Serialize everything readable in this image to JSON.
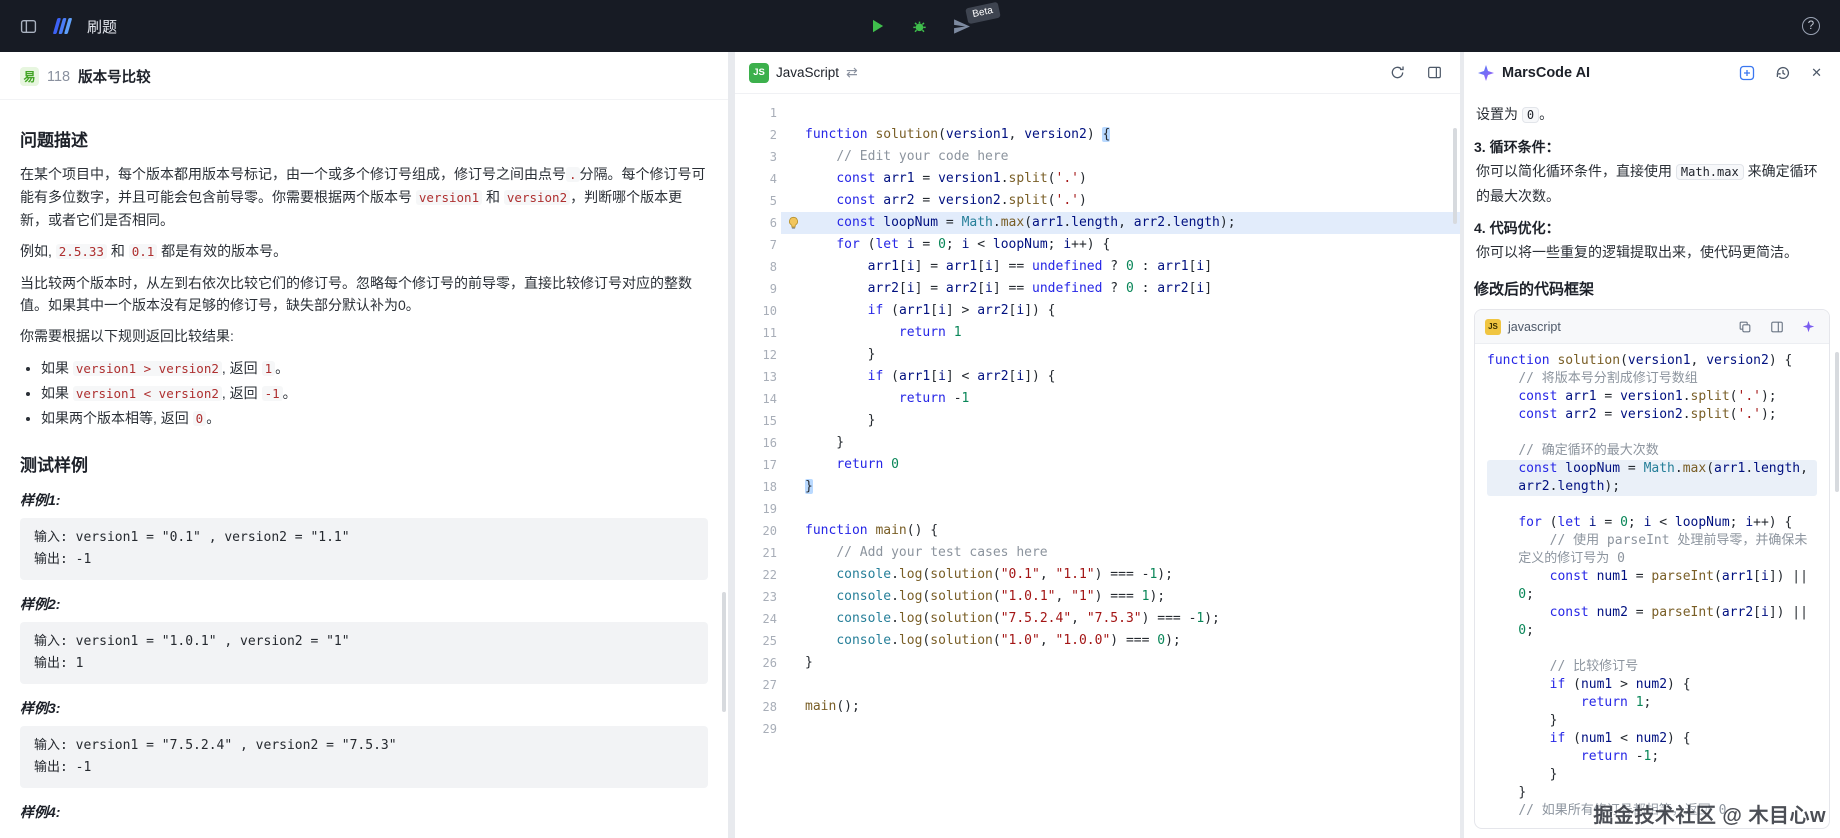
{
  "colors": {
    "topbar_bg": "#171b24",
    "accent_green": "#3fbf4c",
    "brand_blue": "#4a7df7",
    "badge_green_bg": "#e7f6df",
    "badge_green_text": "#41a423",
    "active_line_bg": "#e2ecfb",
    "ai_highlight_bg": "#eaf0f8"
  },
  "icons": {
    "swap": "⇄",
    "help": "?",
    "close": "✕"
  },
  "topbar": {
    "brand": "刷题",
    "beta": "Beta"
  },
  "problem": {
    "difficulty": "易",
    "id": "118",
    "title": "版本号比较",
    "desc_heading": "问题描述",
    "paragraphs": [
      [
        {
          "t": "在某个项目中，每个版本都用版本号标记，由一个或多个修订号组成，修订号之间由点号"
        },
        {
          "t": ".",
          "c": true
        },
        {
          "t": "分隔。每个修订号可能有多位数字，并且可能会包含前导零。你需要根据两个版本号 "
        },
        {
          "t": "version1",
          "c": true
        },
        {
          "t": " 和 "
        },
        {
          "t": "version2",
          "c": true
        },
        {
          "t": "，判断哪个版本更新，或者它们是否相同。"
        }
      ],
      [
        {
          "t": "例如, "
        },
        {
          "t": "2.5.33",
          "c": true
        },
        {
          "t": " 和 "
        },
        {
          "t": "0.1",
          "c": true
        },
        {
          "t": " 都是有效的版本号。"
        }
      ],
      [
        {
          "t": "当比较两个版本时，从左到右依次比较它们的修订号。忽略每个修订号的前导零，直接比较修订号对应的整数值。如果其中一个版本没有足够的修订号，缺失部分默认补为0。"
        }
      ],
      [
        {
          "t": "你需要根据以下规则返回比较结果:"
        }
      ]
    ],
    "rules": [
      [
        {
          "t": "如果 "
        },
        {
          "t": "version1 > version2",
          "c": true
        },
        {
          "t": ", 返回 "
        },
        {
          "t": "1",
          "c": true
        },
        {
          "t": "。"
        }
      ],
      [
        {
          "t": "如果 "
        },
        {
          "t": "version1 < version2",
          "c": true
        },
        {
          "t": ", 返回 "
        },
        {
          "t": "-1",
          "c": true
        },
        {
          "t": "。"
        }
      ],
      [
        {
          "t": "如果两个版本相等, 返回 "
        },
        {
          "t": "0",
          "c": true
        },
        {
          "t": "。"
        }
      ]
    ],
    "samples_heading": "测试样例",
    "samples": [
      {
        "label": "样例1:",
        "input": "输入: version1 = \"0.1\" , version2 = \"1.1\"",
        "output": "输出: -1"
      },
      {
        "label": "样例2:",
        "input": "输入: version1 = \"1.0.1\" , version2 = \"1\"",
        "output": "输出: 1"
      },
      {
        "label": "样例3:",
        "input": "输入: version1 = \"7.5.2.4\" , version2 = \"7.5.3\"",
        "output": "输出: -1"
      },
      {
        "label": "样例4:",
        "input": "",
        "output": ""
      }
    ]
  },
  "editor": {
    "language": "JavaScript",
    "active_line": 6,
    "bracket_highlight_lines": [
      2,
      18
    ],
    "lines": [
      "",
      "function solution(version1, version2) {",
      "    // Edit your code here",
      "    const arr1 = version1.split('.')",
      "    const arr2 = version2.split('.')",
      "    const loopNum = Math.max(arr1.length, arr2.length);",
      "    for (let i = 0; i < loopNum; i++) {",
      "        arr1[i] = arr1[i] == undefined ? 0 : arr1[i]",
      "        arr2[i] = arr2[i] == undefined ? 0 : arr2[i]",
      "        if (arr1[i] > arr2[i]) {",
      "            return 1",
      "        }",
      "        if (arr1[i] < arr2[i]) {",
      "            return -1",
      "        }",
      "    }",
      "    return 0",
      "}",
      "",
      "function main() {",
      "    // Add your test cases here",
      "    console.log(solution(\"0.1\", \"1.1\") === -1);",
      "    console.log(solution(\"1.0.1\", \"1\") === 1);",
      "    console.log(solution(\"7.5.2.4\", \"7.5.3\") === -1);",
      "    console.log(solution(\"1.0\", \"1.0.0\") === 0);",
      "}",
      "",
      "main();",
      ""
    ]
  },
  "ai": {
    "title": "MarsCode AI",
    "intro": [
      {
        "t": "设置为 "
      },
      {
        "t": "0",
        "c": true
      },
      {
        "t": "。"
      }
    ],
    "tips": [
      {
        "label": "3. 循环条件：",
        "body": [
          {
            "t": "你可以简化循环条件，直接使用 "
          },
          {
            "t": "Math.max",
            "c": true
          },
          {
            "t": " 来确定循环的最大次数。"
          }
        ]
      },
      {
        "label": "4. 代码优化：",
        "body": [
          {
            "t": "你可以将一些重复的逻辑提取出来，使代码更简洁。"
          }
        ]
      }
    ],
    "code_heading": "修改后的代码框架",
    "code_lang": "javascript",
    "highlight_line_index": 6,
    "code_lines": [
      "function solution(version1, version2) {",
      "    // 将版本号分割成修订号数组",
      "    const arr1 = version1.split('.');",
      "    const arr2 = version2.split('.');",
      "",
      "    // 确定循环的最大次数",
      "    const loopNum = Math.max(arr1.length, arr2.length);",
      "",
      "    for (let i = 0; i < loopNum; i++) {",
      "        // 使用 parseInt 处理前导零，并确保未定义的修订号为 0",
      "        const num1 = parseInt(arr1[i]) || 0;",
      "        const num2 = parseInt(arr2[i]) || 0;",
      "",
      "        // 比较修订号",
      "        if (num1 > num2) {",
      "            return 1;",
      "        }",
      "        if (num1 < num2) {",
      "            return -1;",
      "        }",
      "    }",
      "    // 如果所有修订号都相等，返回 0"
    ],
    "watermark": "掘金技术社区 @ 木目心w"
  }
}
